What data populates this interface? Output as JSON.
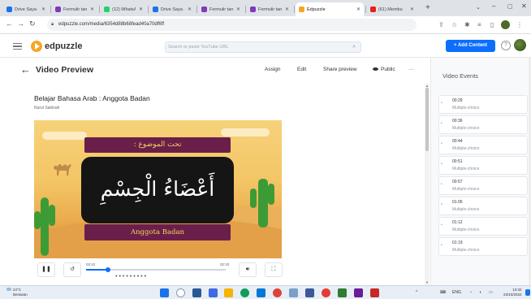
{
  "browser": {
    "tabs": [
      {
        "label": "Drive Saya - ",
        "fav_color": "#1a73e8"
      },
      {
        "label": "Formulir tan",
        "fav_color": "#7e3bb5"
      },
      {
        "label": "(12) WhatsAp",
        "fav_color": "#25d366"
      },
      {
        "label": "Drive Saya - ",
        "fav_color": "#1a73e8"
      },
      {
        "label": "Formulir tan",
        "fav_color": "#7e3bb5"
      },
      {
        "label": "Formulir tan",
        "fav_color": "#7e3bb5"
      },
      {
        "label": "Edpuzzle",
        "fav_color": "#f5a623"
      },
      {
        "label": "(61) Membu",
        "fav_color": "#e62117"
      }
    ],
    "url": "edpuzzle.com/media/6354d88b68fead40a70df6ff"
  },
  "header": {
    "brand": "edpuzzle",
    "search_placeholder": "Search or paste YouTube URL",
    "add_content": "+ Add Content",
    "help": "?"
  },
  "toolbar": {
    "title": "Video Preview",
    "assign": "Assign",
    "edit": "Edit",
    "share_preview": "Share preview",
    "public": "Public",
    "more": "···"
  },
  "video": {
    "title": "Belajar Bahasa Arab : Anggota Badan",
    "author": "Nurul Sakinah",
    "banner_arabic": "تحت الموضوع :",
    "board_arabic": "أَعْضَاءُ الْجِسْمِ",
    "subtitle": "Anggota Badan",
    "current_time": "00:22",
    "duration": "02:20",
    "progress": 0.157,
    "question_markers": 9
  },
  "sidebar": {
    "title": "Video Events",
    "events": [
      {
        "time": "00:29",
        "type": "Multiple-choice"
      },
      {
        "time": "00:36",
        "type": "Multiple-choice"
      },
      {
        "time": "00:44",
        "type": "Multiple-choice"
      },
      {
        "time": "00:51",
        "type": "Multiple-choice"
      },
      {
        "time": "00:57",
        "type": "Multiple-choice"
      },
      {
        "time": "01:05",
        "type": "Multiple-choice"
      },
      {
        "time": "01:12",
        "type": "Multiple-choice"
      },
      {
        "time": "01:19",
        "type": "Multiple-choice"
      }
    ]
  },
  "taskbar": {
    "weather_temp": "24°C",
    "weather_desc": "Berawan",
    "lang": "ENG",
    "time": "13:32",
    "date": "23/10/2022"
  }
}
